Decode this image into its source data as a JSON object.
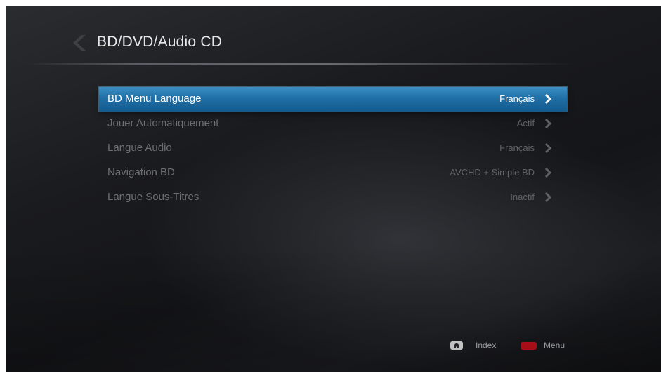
{
  "header": {
    "title": "BD/DVD/Audio CD",
    "back_icon": "back-chevron-icon"
  },
  "menu": {
    "items": [
      {
        "label": "BD Menu Language",
        "value": "Français",
        "selected": true
      },
      {
        "label": "Jouer Automatiquement",
        "value": "Actif",
        "selected": false
      },
      {
        "label": "Langue Audio",
        "value": "Français",
        "selected": false
      },
      {
        "label": "Navigation BD",
        "value": "AVCHD + Simple BD",
        "selected": false
      },
      {
        "label": "Langue Sous-Titres",
        "value": "Inactif",
        "selected": false
      }
    ]
  },
  "footer": {
    "index_icon": "home-icon",
    "index_label": "Index",
    "menu_icon": "red-button-icon",
    "menu_label": "Menu"
  },
  "colors": {
    "selection": "#1f6fa6",
    "red_button": "#d0121d",
    "background": "#1a1b1e"
  }
}
